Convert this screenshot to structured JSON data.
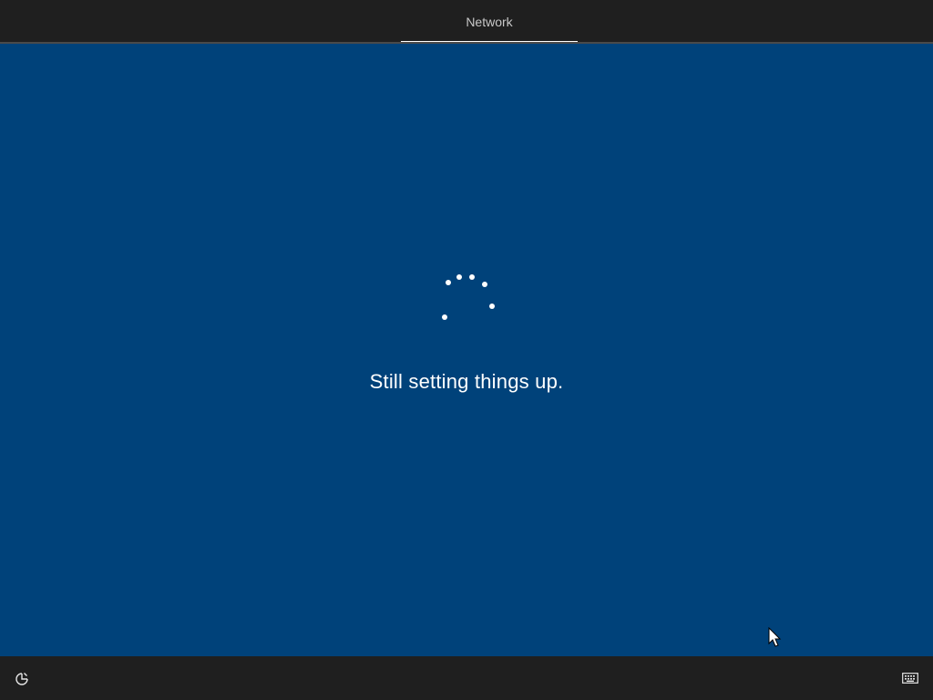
{
  "topbar": {
    "tabs": [
      {
        "label": "Network",
        "active": true
      }
    ]
  },
  "main": {
    "status_text": "Still setting things up.",
    "spinner_icon": "loading-dots-icon"
  },
  "bottombar": {
    "left_icon": "ease-of-access-icon",
    "right_icon": "keyboard-icon"
  },
  "colors": {
    "background": "#00427a",
    "bars": "#1f1f1f",
    "text": "#ffffff",
    "tab_text": "#c8c8c8"
  }
}
